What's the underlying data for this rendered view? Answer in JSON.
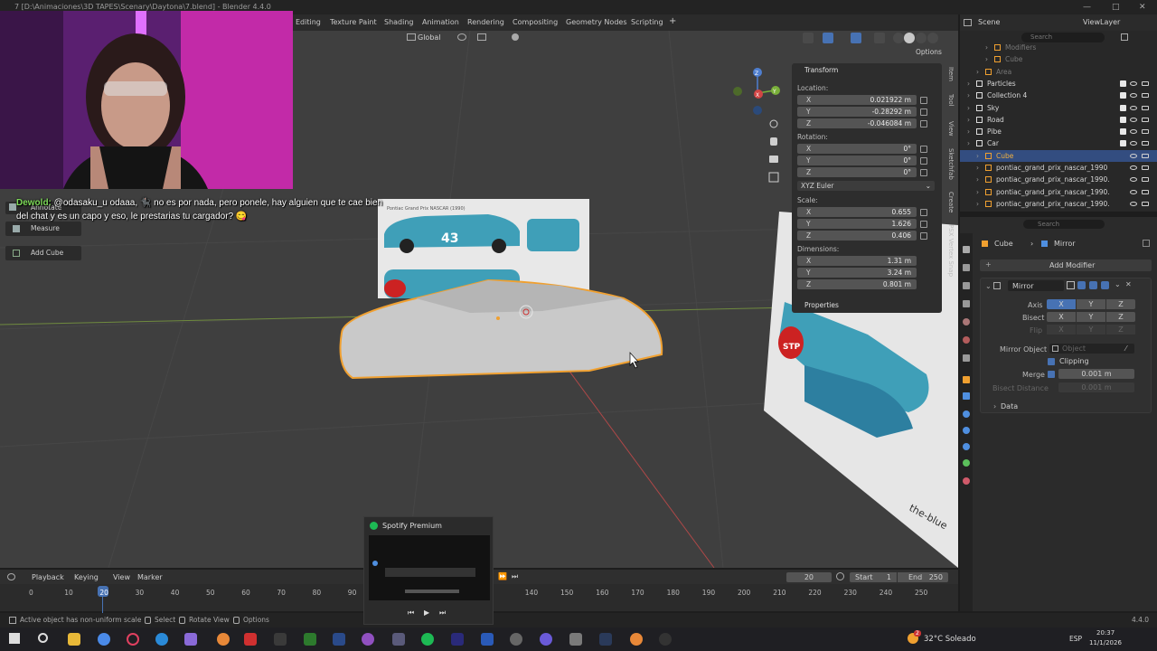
{
  "window": {
    "title": "7 [D:\\Animaciones\\3D TAPES\\Scenary\\Daytona\\7.blend] - Blender 4.4.0",
    "minimize": "—",
    "maximize": "□",
    "close": "✕"
  },
  "workspaces": [
    "Editing",
    "Texture Paint",
    "Shading",
    "Animation",
    "Rendering",
    "Compositing",
    "Geometry Nodes",
    "Scripting",
    "+"
  ],
  "viewport": {
    "orientation": "Global",
    "options_label": "Options",
    "tools": [
      {
        "label": "Annotate",
        "icon": "annotate-icon"
      },
      {
        "label": "Measure",
        "icon": "measure-icon"
      },
      {
        "label": "Add Cube",
        "icon": "add-cube-icon"
      }
    ],
    "gizmo": {
      "x": "X",
      "y": "Y",
      "z": "Z"
    },
    "reference_text": "Pontiac Grand Prix NASCAR (1990)",
    "car_number": "43",
    "stp": "STP",
    "brand_text": "the-blue"
  },
  "chat": {
    "user": "Dewold:",
    "message": "@odasaku_u odaaa, 🐈‍⬛ no es por nada, pero ponele, hay alguien que te cae bien del chat y es un capo y eso, le prestarias tu cargador? 😋"
  },
  "npanel": {
    "transform_label": "Transform",
    "location_label": "Location:",
    "location": [
      {
        "axis": "X",
        "value": "0.021922 m"
      },
      {
        "axis": "Y",
        "value": "-0.28292 m"
      },
      {
        "axis": "Z",
        "value": "-0.046084 m"
      }
    ],
    "rotation_label": "Rotation:",
    "rotation": [
      {
        "axis": "X",
        "value": "0°"
      },
      {
        "axis": "Y",
        "value": "0°"
      },
      {
        "axis": "Z",
        "value": "0°"
      }
    ],
    "rotation_mode": "XYZ Euler",
    "scale_label": "Scale:",
    "scale": [
      {
        "axis": "X",
        "value": "0.655"
      },
      {
        "axis": "Y",
        "value": "1.626"
      },
      {
        "axis": "Z",
        "value": "0.406"
      }
    ],
    "dimensions_label": "Dimensions:",
    "dimensions": [
      {
        "axis": "X",
        "value": "1.31 m"
      },
      {
        "axis": "Y",
        "value": "3.24 m"
      },
      {
        "axis": "Z",
        "value": "0.801 m"
      }
    ],
    "properties_label": "Properties",
    "side_tabs": [
      "Item",
      "Tool",
      "View",
      "Sketchfab",
      "Create",
      "PSX Vertex Snap"
    ]
  },
  "outliner": {
    "scene": "Scene",
    "view_layer": "ViewLayer",
    "search_placeholder": "Search",
    "rows": [
      {
        "name": "Modifiers",
        "indent": 3,
        "faded": true
      },
      {
        "name": "Cube",
        "indent": 3,
        "faded": true
      },
      {
        "name": "Area",
        "indent": 2,
        "faded": true
      },
      {
        "name": "Particles",
        "indent": 1
      },
      {
        "name": "Collection 4",
        "indent": 1
      },
      {
        "name": "Sky",
        "indent": 1
      },
      {
        "name": "Road",
        "indent": 1
      },
      {
        "name": "Pibe",
        "indent": 1
      },
      {
        "name": "Car",
        "indent": 1
      },
      {
        "name": "Cube",
        "indent": 2,
        "selected": true
      },
      {
        "name": "pontiac_grand_prix_nascar_1990",
        "indent": 2
      },
      {
        "name": "pontiac_grand_prix_nascar_1990.",
        "indent": 2
      },
      {
        "name": "pontiac_grand_prix_nascar_1990.",
        "indent": 2
      },
      {
        "name": "pontiac_grand_prix_nascar_1990.",
        "indent": 2
      }
    ]
  },
  "properties": {
    "search_placeholder": "Search",
    "breadcrumb_object": "Cube",
    "breadcrumb_sep": "›",
    "breadcrumb_modifier": "Mirror",
    "add_modifier": "Add Modifier",
    "modifier_name": "Mirror",
    "axis_label": "Axis",
    "bisect_label": "Bisect",
    "flip_label": "Flip",
    "axes": [
      "X",
      "Y",
      "Z"
    ],
    "mirror_object_label": "Mirror Object",
    "mirror_object_placeholder": "Object",
    "clipping_label": "Clipping",
    "merge_label": "Merge",
    "merge_value": "0.001 m",
    "bisect_distance_label": "Bisect Distance",
    "bisect_distance_value": "0.001 m",
    "data_label": "Data"
  },
  "timeline": {
    "menus": [
      "Playback",
      "Keying",
      "View",
      "Marker"
    ],
    "current_frame": "20",
    "start_label": "Start",
    "start": "1",
    "end_label": "End",
    "end": "250",
    "ticks": [
      "0",
      "10",
      "20",
      "30",
      "40",
      "50",
      "60",
      "70",
      "80",
      "90",
      "140",
      "150",
      "160",
      "170",
      "180",
      "190",
      "200",
      "210",
      "220",
      "230",
      "240",
      "250"
    ]
  },
  "statusbar": {
    "message": "Active object has non-uniform scale",
    "select": "Select",
    "rotate_view": "Rotate View",
    "options": "Options",
    "version": "4.4.0"
  },
  "spotify": {
    "title": "Spotify Premium",
    "prev": "⏮",
    "play": "▶",
    "next": "⏭"
  },
  "taskbar": {
    "weather_badge": "2",
    "weather": "32°C  Soleado",
    "lang": "ESP",
    "time": "20:37",
    "date": "11/1/2026"
  }
}
